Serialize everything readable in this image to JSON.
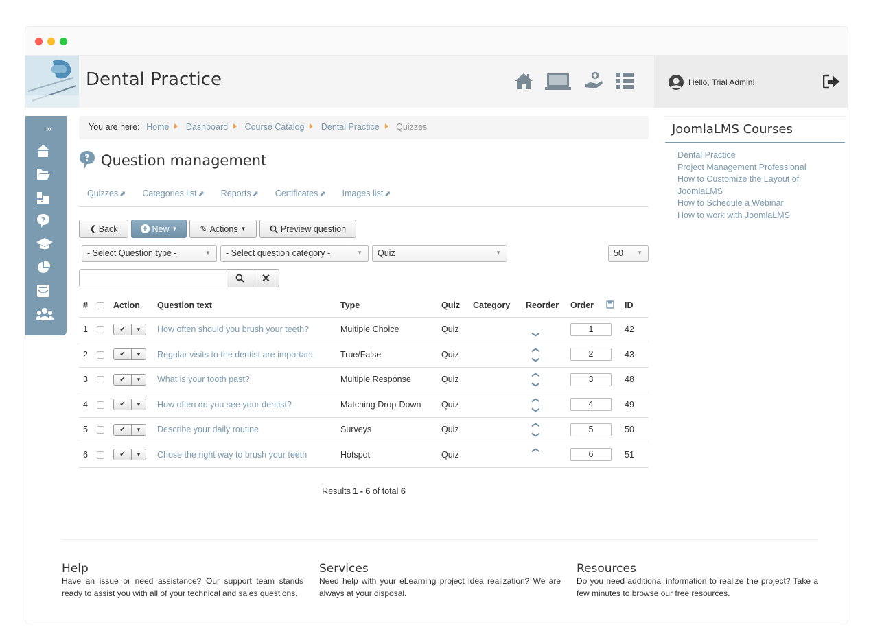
{
  "header": {
    "site_title": "Dental Practice",
    "greeting": "Hello, Trial Admin!"
  },
  "sidebar": {
    "toggle_label": "»"
  },
  "breadcrumb": {
    "prefix": "You are here:",
    "items": [
      "Home",
      "Dashboard",
      "Course Catalog",
      "Dental Practice",
      "Quizzes"
    ]
  },
  "page": {
    "title": "Question management"
  },
  "subnav": [
    "Quizzes",
    "Categories list",
    "Reports",
    "Certificates",
    "Images list"
  ],
  "toolbar": {
    "back_label": "Back",
    "new_label": "New",
    "actions_label": "Actions",
    "preview_label": "Preview question"
  },
  "filters": {
    "question_type": "- Select Question type -",
    "question_category": "- Select question category -",
    "quiz": "Quiz",
    "per_page": "50",
    "search_value": ""
  },
  "table": {
    "headers": {
      "num": "#",
      "action": "Action",
      "text": "Question text",
      "type": "Type",
      "quiz": "Quiz",
      "category": "Category",
      "reorder": "Reorder",
      "order": "Order",
      "id": "ID"
    },
    "rows": [
      {
        "num": "1",
        "text": "How often should you brush your teeth?",
        "type": "Multiple Choice",
        "quiz": "Quiz",
        "category": "",
        "up": false,
        "down": true,
        "order": "1",
        "id": "42"
      },
      {
        "num": "2",
        "text": "Regular visits to the dentist are important",
        "type": "True/False",
        "quiz": "Quiz",
        "category": "",
        "up": true,
        "down": true,
        "order": "2",
        "id": "43"
      },
      {
        "num": "3",
        "text": "What is your tooth past?",
        "type": "Multiple Response",
        "quiz": "Quiz",
        "category": "",
        "up": true,
        "down": true,
        "order": "3",
        "id": "48"
      },
      {
        "num": "4",
        "text": "How often do you see your dentist?",
        "type": "Matching Drop-Down",
        "quiz": "Quiz",
        "category": "",
        "up": true,
        "down": true,
        "order": "4",
        "id": "49"
      },
      {
        "num": "5",
        "text": "Describe your daily routine",
        "type": "Surveys",
        "quiz": "Quiz",
        "category": "",
        "up": true,
        "down": true,
        "order": "5",
        "id": "50"
      },
      {
        "num": "6",
        "text": "Chose the right way to brush your teeth",
        "type": "Hotspot",
        "quiz": "Quiz",
        "category": "",
        "up": true,
        "down": false,
        "order": "6",
        "id": "51"
      }
    ]
  },
  "results": {
    "prefix": "Results",
    "range": "1 - 6",
    "middle": "of total",
    "total": "6"
  },
  "right_panel": {
    "title": "JoomlaLMS Courses",
    "courses": [
      "Dental Practice",
      "Project Management Professional",
      "How to Customize the Layout of JoomlaLMS",
      "How to Schedule a Webinar",
      "How to work with JoomlaLMS"
    ]
  },
  "footer": {
    "help_title": "Help",
    "help_text": "Have an issue or need assistance? Our support team stands ready to assist you with all of your technical and sales questions.",
    "services_title": "Services",
    "services_text": "Need help with your eLearning project idea realization? We are always at your disposal.",
    "resources_title": "Resources",
    "resources_text": "Do you need additional information to realize the project? Take a few minutes to browse our free resources."
  },
  "colors": {
    "accent": "#7b9bb1",
    "breadcrumb_separator": "#f0a04b",
    "window_close": "#ff5f57",
    "window_minimize": "#febc2e",
    "window_zoom": "#28c840"
  }
}
